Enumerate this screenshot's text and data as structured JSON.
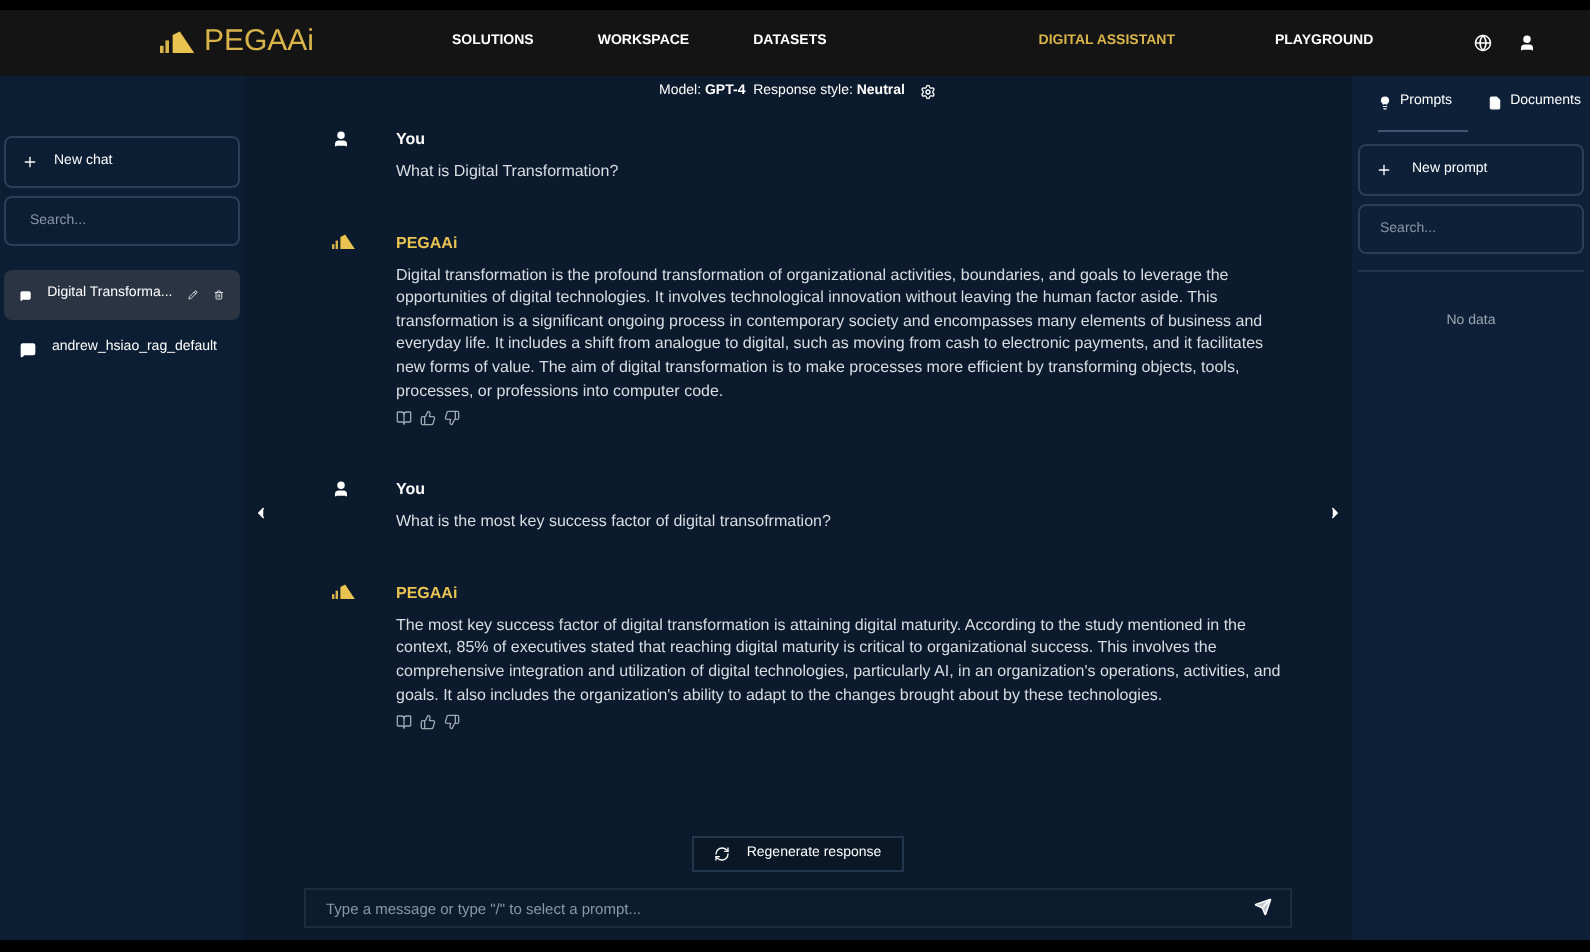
{
  "header": {
    "logo": "PEGAAi",
    "nav": [
      {
        "label": "SOLUTIONS",
        "selected": false
      },
      {
        "label": "WORKSPACE",
        "selected": false
      },
      {
        "label": "DATASETS",
        "selected": false
      },
      {
        "label": "DIGITAL ASSISTANT",
        "selected": true
      },
      {
        "label": "PLAYGROUND",
        "selected": false
      }
    ]
  },
  "sidebar": {
    "new_chat": "New chat",
    "search": {
      "placeholder": "Search..."
    },
    "chats": [
      {
        "title": "Digital Transforma...",
        "selected": true
      },
      {
        "title": "andrew_hsiao_rag_default",
        "selected": false
      }
    ]
  },
  "chat": {
    "settings": "Model: **GPT-4**  Response style: **Neutral**",
    "messages": [
      {
        "kind": "user",
        "author": "You",
        "text": "What is Digital Transformation?"
      },
      {
        "kind": "bot",
        "author": "PEGAAi",
        "text": "Digital transformation is the profound transformation of organizational activities, boundaries, and goals to leverage the opportunities of digital technologies. It involves technological innovation without leaving the human factor aside. This transformation is a significant ongoing process in contemporary society and encompasses many elements of business and everyday life. It includes a shift from analogue to digital, such as moving from cash to electronic payments, and it facilitates new forms of value. The aim of digital transformation is to make processes more efficient by transforming objects, tools, processes, or professions into computer code."
      },
      {
        "kind": "user",
        "author": "You",
        "text": "What is the most key success factor of digital transofrmation?"
      },
      {
        "kind": "bot",
        "author": "PEGAAi",
        "text": "The most key success factor of digital transformation is attaining digital maturity. According to the study mentioned in the context, 85% of executives stated that reaching digital maturity is critical to organizational success. This involves the comprehensive integration and utilization of digital technologies, particularly AI, in an organization's operations, activities, and goals. It also includes the organization's ability to adapt to the changes brought about by these technologies."
      }
    ],
    "regenerate": "Regenerate response",
    "input": {
      "placeholder": "Type a message or type \"/\" to select a prompt..."
    }
  },
  "right_panel": {
    "tabs": [
      {
        "label": "Prompts",
        "kind": "prompts",
        "selected": true
      },
      {
        "label": "Documents",
        "kind": "documents",
        "selected": false
      }
    ],
    "new_prompt": "New prompt",
    "search": {
      "placeholder": "Search..."
    },
    "empty": "No data"
  }
}
